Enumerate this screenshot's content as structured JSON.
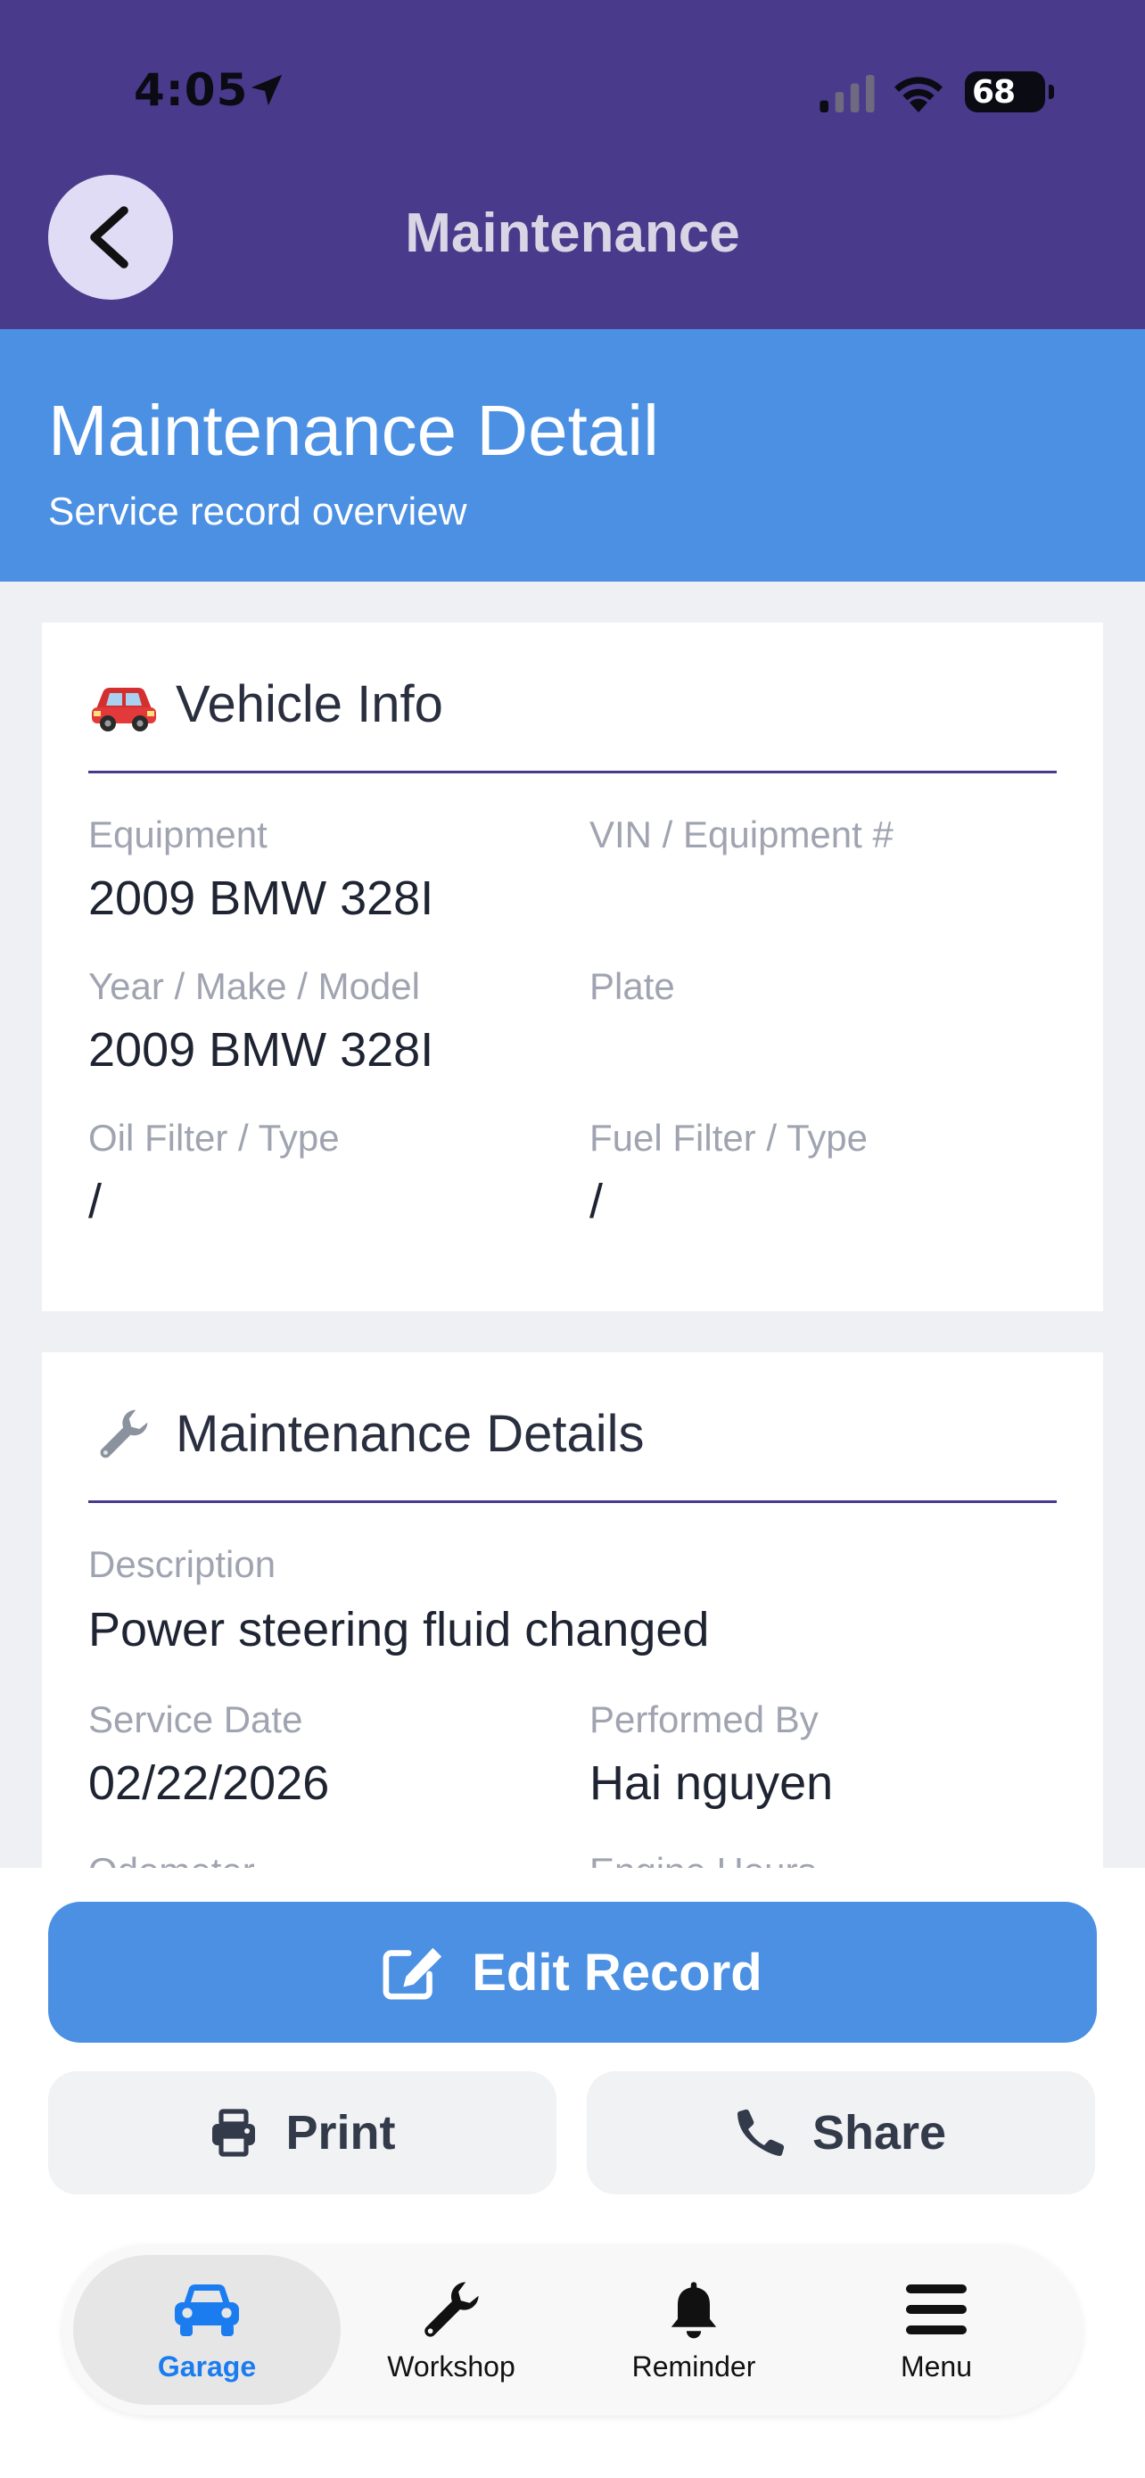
{
  "status_bar": {
    "time": "4:05",
    "battery": "68"
  },
  "nav": {
    "title": "Maintenance",
    "back_icon": "chevron-left-icon"
  },
  "header": {
    "title": "Maintenance Detail",
    "subtitle": "Service record overview"
  },
  "vehicle_info": {
    "title": "Vehicle Info",
    "icon": "car-icon",
    "fields": {
      "equipment_label": "Equipment",
      "equipment_value": "2009 BMW 328I",
      "vin_label": "VIN / Equipment #",
      "vin_value": "",
      "ymm_label": "Year / Make / Model",
      "ymm_value": "2009 BMW 328I",
      "plate_label": "Plate",
      "plate_value": "",
      "oil_label": "Oil Filter / Type",
      "oil_value": "/",
      "fuel_label": "Fuel Filter / Type",
      "fuel_value": "/"
    }
  },
  "maintenance_details": {
    "title": "Maintenance Details",
    "icon": "wrench-icon",
    "fields": {
      "description_label": "Description",
      "description_value": "Power steering fluid changed",
      "service_date_label": "Service Date",
      "service_date_value": "02/22/2026",
      "performed_by_label": "Performed By",
      "performed_by_value": "Hai nguyen",
      "odometer_label": "Odometer",
      "engine_hours_label": "Engine Hours"
    }
  },
  "actions": {
    "edit_label": "Edit Record",
    "print_label": "Print",
    "share_label": "Share"
  },
  "tabs": [
    {
      "label": "Garage",
      "icon": "car-icon"
    },
    {
      "label": "Workshop",
      "icon": "wrench-icon"
    },
    {
      "label": "Reminder",
      "icon": "bell-icon"
    },
    {
      "label": "Menu",
      "icon": "menu-icon"
    }
  ],
  "colors": {
    "nav_bg": "#493a8c",
    "header_bg": "#4b90e2",
    "accent_blue": "#4b90e2",
    "active_tab": "#1b7cf0"
  }
}
